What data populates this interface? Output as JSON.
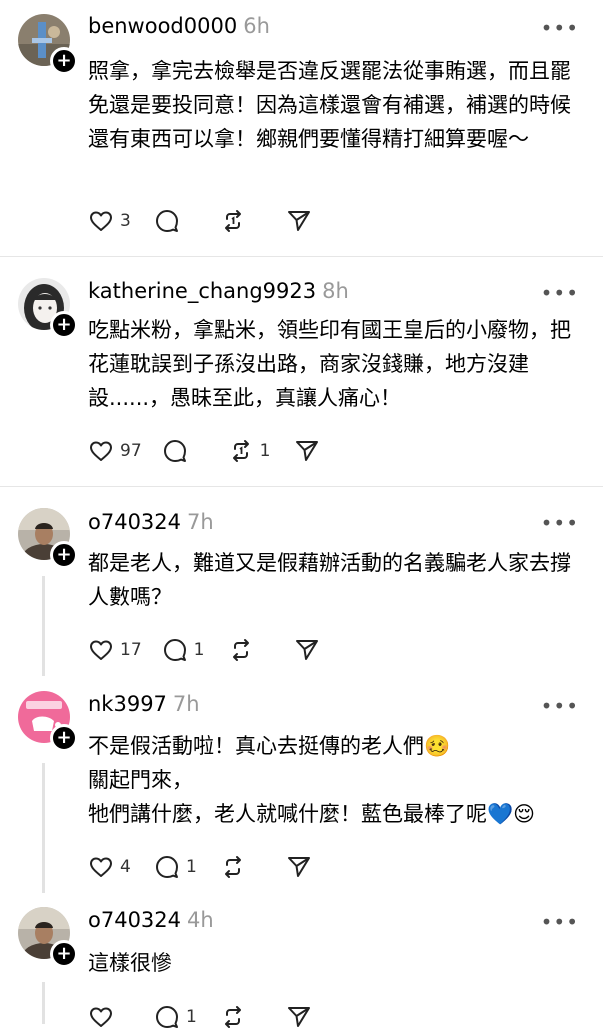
{
  "posts": [
    {
      "username": "benwood0000",
      "time": "6h",
      "text": "照拿，拿完去檢舉是否違反選罷法從事賄選，而且罷免還是要投同意！因為這樣還會有補選，補選的時候還有東西可以拿！鄉親們要懂得精打細算要喔～",
      "likes": "3",
      "replies": "",
      "reposts": ""
    },
    {
      "username": "katherine_chang9923",
      "time": "8h",
      "text": "吃點米粉，拿點米，領些印有國王皇后的小廢物，把花蓮耽誤到子孫沒出路，商家沒錢賺，地方沒建設......，愚昧至此，真讓人痛心！",
      "likes": "97",
      "replies": "",
      "reposts": "1"
    },
    {
      "username": "o740324",
      "time": "7h",
      "text": "都是老人，難道又是假藉辦活動的名義騙老人家去撐人數嗎？",
      "likes": "17",
      "replies": "1",
      "reposts": ""
    },
    {
      "username": "nk3997",
      "time": "7h",
      "text": "不是假活動啦！真心去挺傳的老人們🥴\n關起門來，\n牠們講什麼，老人就喊什麼！藍色最棒了呢💙😌",
      "likes": "4",
      "replies": "1",
      "reposts": ""
    },
    {
      "username": "o740324",
      "time": "4h",
      "text": "這樣很慘",
      "likes": "",
      "replies": "1",
      "reposts": ""
    }
  ],
  "more_label": "•••",
  "follow_label": "+",
  "icons": {
    "like": "heart-icon",
    "reply": "comment-icon",
    "repost": "repost-icon",
    "share": "share-icon"
  },
  "colors": {
    "time": "#999999",
    "divider": "#e6e6e6",
    "thread_line": "#e2e2e2"
  }
}
